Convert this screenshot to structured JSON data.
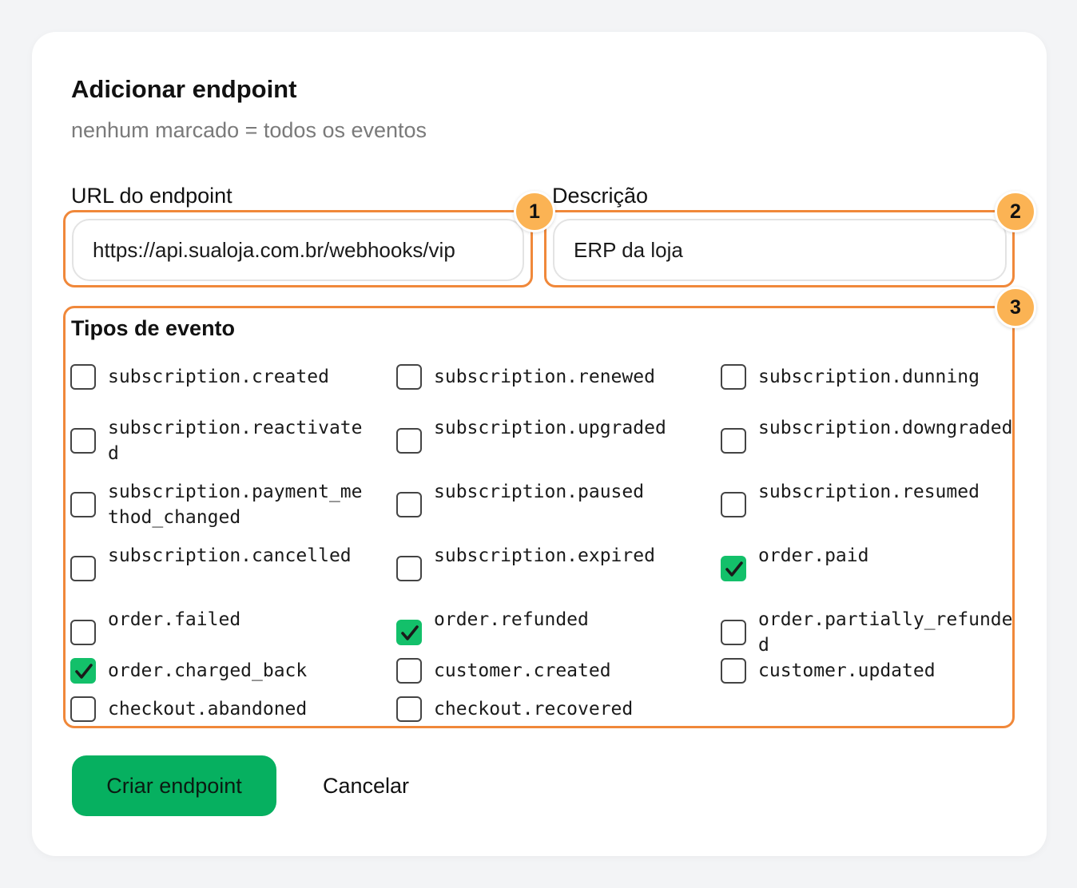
{
  "dialog": {
    "title": "Adicionar endpoint",
    "subtitle": "nenhum marcado = todos os eventos"
  },
  "form": {
    "url_label": "URL do endpoint",
    "url_value": "https://api.sualoja.com.br/webhooks/vip",
    "description_label": "Descrição",
    "description_value": "ERP da loja",
    "events_label": "Tipos de evento"
  },
  "annotations": [
    "1",
    "2",
    "3"
  ],
  "events": [
    {
      "label": "subscription.created",
      "checked": false
    },
    {
      "label": "subscription.renewed",
      "checked": false
    },
    {
      "label": "subscription.dunning",
      "checked": false
    },
    {
      "label": "subscription.reactivated",
      "checked": false
    },
    {
      "label": "subscription.upgraded",
      "checked": false
    },
    {
      "label": "subscription.downgraded",
      "checked": false
    },
    {
      "label": "subscription.payment_method_changed",
      "checked": false
    },
    {
      "label": "subscription.paused",
      "checked": false
    },
    {
      "label": "subscription.resumed",
      "checked": false
    },
    {
      "label": "subscription.cancelled",
      "checked": false
    },
    {
      "label": "subscription.expired",
      "checked": false
    },
    {
      "label": "order.paid",
      "checked": true
    },
    {
      "label": "order.failed",
      "checked": false
    },
    {
      "label": "order.refunded",
      "checked": true
    },
    {
      "label": "order.partially_refunded",
      "checked": false
    },
    {
      "label": "order.charged_back",
      "checked": true
    },
    {
      "label": "customer.created",
      "checked": false
    },
    {
      "label": "customer.updated",
      "checked": false
    },
    {
      "label": "checkout.abandoned",
      "checked": false
    },
    {
      "label": "checkout.recovered",
      "checked": false
    }
  ],
  "actions": {
    "create_label": "Criar endpoint",
    "cancel_label": "Cancelar"
  },
  "colors": {
    "accent": "#06b060",
    "annotation": "#f0883a",
    "badge": "#fbb354",
    "checked": "#13c06a"
  }
}
